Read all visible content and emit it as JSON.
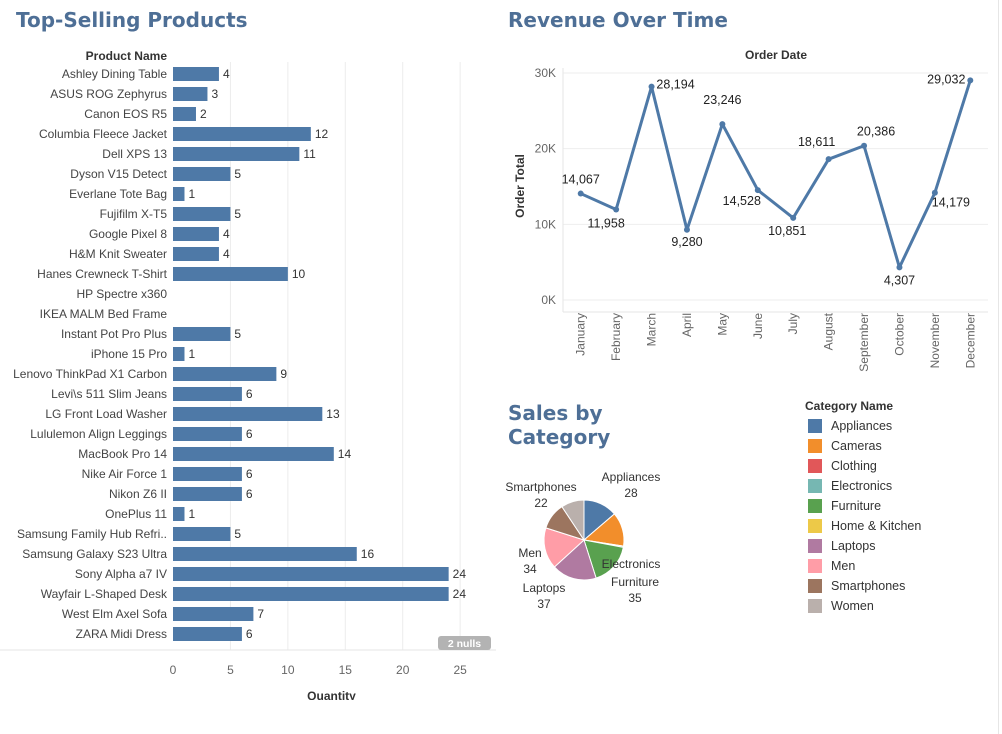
{
  "dashboard": {
    "panels": {
      "top_products_title": "Top-Selling Products",
      "revenue_title": "Revenue Over Time",
      "category_title_line1": "Sales by",
      "category_title_line2": "Category"
    },
    "legend": {
      "title": "Category Name",
      "items": [
        {
          "label": "Appliances",
          "color": "#4e79a7"
        },
        {
          "label": "Cameras",
          "color": "#f28e2b"
        },
        {
          "label": "Clothing",
          "color": "#e15759"
        },
        {
          "label": "Electronics",
          "color": "#76b7b2"
        },
        {
          "label": "Furniture",
          "color": "#59a14f"
        },
        {
          "label": "Home & Kitchen",
          "color": "#edc948"
        },
        {
          "label": "Laptops",
          "color": "#b07aa1"
        },
        {
          "label": "Men",
          "color": "#ff9da7"
        },
        {
          "label": "Smartphones",
          "color": "#9c755f"
        },
        {
          "label": "Women",
          "color": "#bab0ac"
        }
      ]
    }
  },
  "chart_data": [
    {
      "type": "bar",
      "orientation": "horizontal",
      "title": "Top-Selling Products",
      "header": "Product Name",
      "xlabel": "Quantity",
      "xticks": [
        0,
        5,
        10,
        15,
        20,
        25
      ],
      "xlim": [
        0,
        27.6
      ],
      "bar_color": "#4e79a7",
      "null_badge": "2 nulls",
      "categories": [
        "Ashley Dining Table",
        "ASUS ROG Zephyrus",
        "Canon EOS R5",
        "Columbia Fleece Jacket",
        "Dell XPS 13",
        "Dyson V15 Detect",
        "Everlane Tote Bag",
        "Fujifilm X-T5",
        "Google Pixel 8",
        "H&M Knit Sweater",
        "Hanes Crewneck T-Shirt",
        "HP Spectre x360",
        "IKEA MALM Bed Frame",
        "Instant Pot Pro Plus",
        "iPhone 15 Pro",
        "Lenovo ThinkPad X1 Carbon",
        "Levi\\s 511 Slim Jeans",
        "LG Front Load Washer",
        "Lululemon Align Leggings",
        "MacBook Pro 14",
        "Nike Air Force 1",
        "Nikon Z6 II",
        "OnePlus 11",
        "Samsung Family Hub Refri..",
        "Samsung Galaxy S23 Ultra",
        "Sony Alpha a7 IV",
        "Wayfair L-Shaped Desk",
        "West Elm Axel Sofa",
        "ZARA Midi Dress"
      ],
      "values": [
        4,
        3,
        2,
        12,
        11,
        5,
        1,
        5,
        4,
        4,
        10,
        null,
        null,
        5,
        1,
        9,
        6,
        13,
        6,
        14,
        6,
        6,
        1,
        5,
        16,
        24,
        24,
        7,
        6
      ]
    },
    {
      "type": "line",
      "title": "Revenue Over Time",
      "header": "Order Date",
      "ylabel": "Order Total",
      "yticks": [
        0,
        10000,
        20000,
        30000
      ],
      "ytick_labels": [
        "0K",
        "10K",
        "20K",
        "30K"
      ],
      "ylim": [
        -1100,
        31000
      ],
      "line_color": "#4e79a7",
      "x": [
        "January",
        "February",
        "March",
        "April",
        "May",
        "June",
        "July",
        "August",
        "September",
        "October",
        "November",
        "December"
      ],
      "values": [
        14067,
        11958,
        28194,
        9280,
        23246,
        14528,
        10851,
        18611,
        20386,
        4307,
        14179,
        29032
      ],
      "value_labels": [
        "14,067",
        "11,958",
        "28,194",
        "9,280",
        "23,246",
        "14,528",
        "10,851",
        "18,611",
        "20,386",
        "4,307",
        "14,179",
        "29,032"
      ]
    },
    {
      "type": "pie",
      "title": "Sales by Category",
      "slices": [
        {
          "label": "Appliances",
          "value": 28,
          "color": "#4e79a7"
        },
        {
          "label": "Cameras",
          "value": 28,
          "color": "#f28e2b"
        },
        {
          "label": "Electronics",
          "value": 1,
          "color": "#76b7b2"
        },
        {
          "label": "Furniture",
          "value": 35,
          "color": "#59a14f"
        },
        {
          "label": "Laptops",
          "value": 37,
          "color": "#b07aa1"
        },
        {
          "label": "Men",
          "value": 34,
          "color": "#ff9da7"
        },
        {
          "label": "Smartphones",
          "value": 22,
          "color": "#9c755f"
        },
        {
          "label": "Women",
          "value": 19,
          "color": "#bab0ac"
        }
      ],
      "slice_labels": [
        {
          "name": "Appliances",
          "value": "28"
        },
        {
          "name": "Electronics",
          "value": ""
        },
        {
          "name": "Furniture",
          "value": "35"
        },
        {
          "name": "Laptops",
          "value": "37"
        },
        {
          "name": "Men",
          "value": "34"
        },
        {
          "name": "Smartphones",
          "value": "22"
        }
      ]
    }
  ]
}
